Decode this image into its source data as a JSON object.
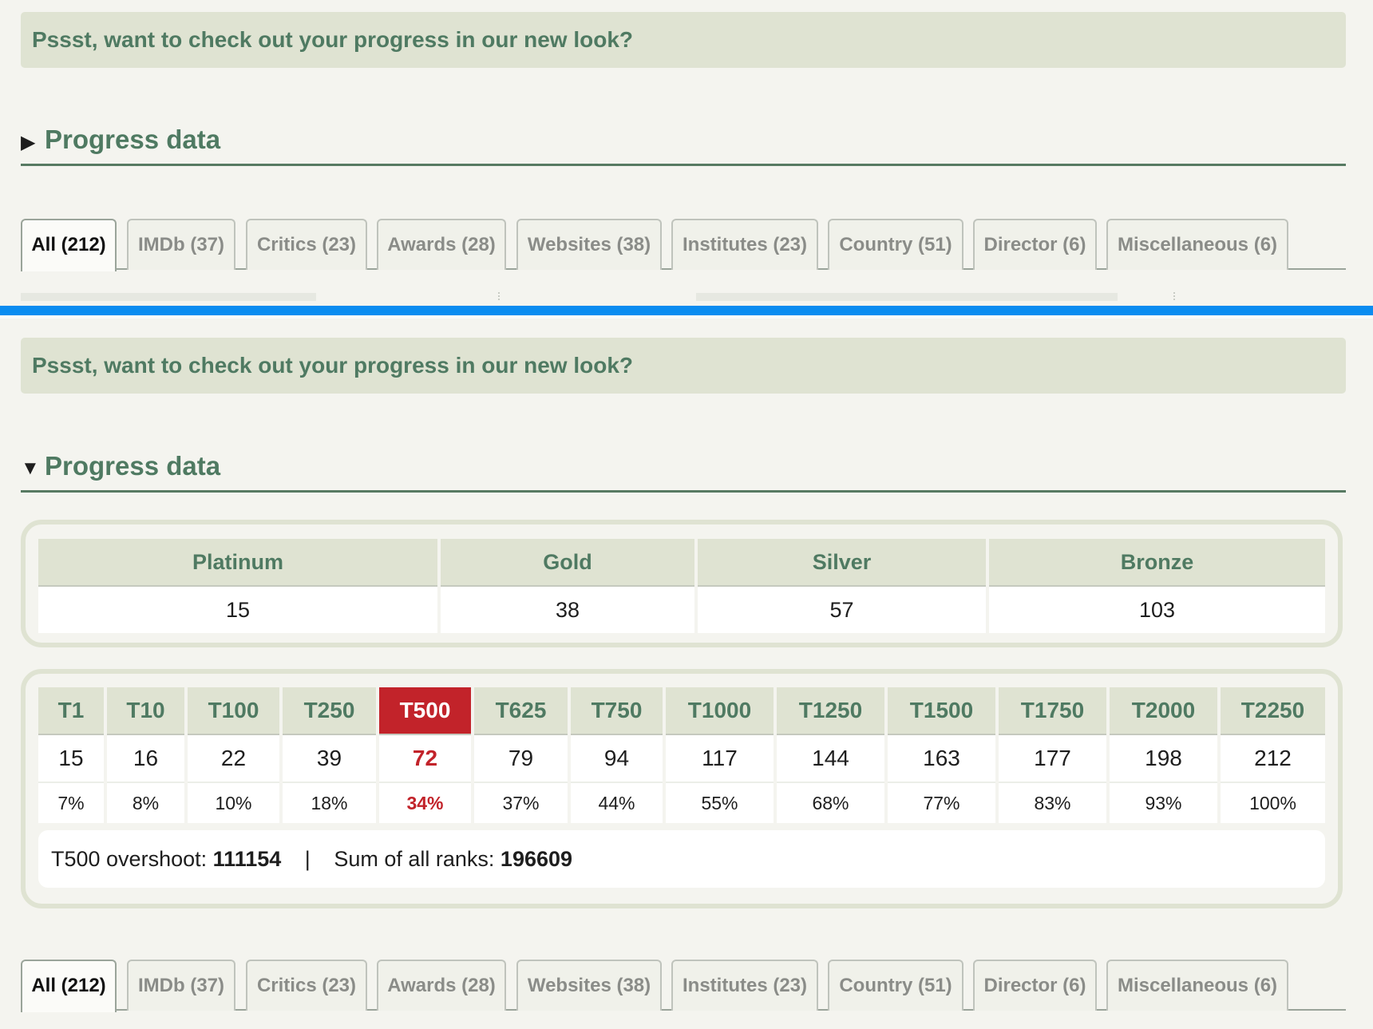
{
  "banner": {
    "text": "Pssst, want to check out your progress in our new look?"
  },
  "progress_section": {
    "title": "Progress data",
    "arrow_collapsed": "▶",
    "arrow_expanded": "▼"
  },
  "tabs": [
    {
      "label": "All (212)",
      "active": true
    },
    {
      "label": "IMDb (37)"
    },
    {
      "label": "Critics (23)"
    },
    {
      "label": "Awards (28)"
    },
    {
      "label": "Websites (38)"
    },
    {
      "label": "Institutes (23)"
    },
    {
      "label": "Country (51)"
    },
    {
      "label": "Director (6)"
    },
    {
      "label": "Miscellaneous (6)"
    }
  ],
  "medals": {
    "headers": [
      "Platinum",
      "Gold",
      "Silver",
      "Bronze"
    ],
    "values": [
      "15",
      "38",
      "57",
      "103"
    ]
  },
  "ranks": {
    "headers": [
      "T1",
      "T10",
      "T100",
      "T250",
      "T500",
      "T625",
      "T750",
      "T1000",
      "T1250",
      "T1500",
      "T1750",
      "T2000",
      "T2250"
    ],
    "counts": [
      "15",
      "16",
      "22",
      "39",
      "72",
      "79",
      "94",
      "117",
      "144",
      "163",
      "177",
      "198",
      "212"
    ],
    "percents": [
      "7%",
      "8%",
      "10%",
      "18%",
      "34%",
      "37%",
      "44%",
      "55%",
      "68%",
      "77%",
      "83%",
      "93%",
      "100%"
    ],
    "highlight": "T500",
    "highlight_color": "#c2232a"
  },
  "summary": {
    "overshoot_label": "T500 overshoot:",
    "overshoot_value": "111154",
    "separator": "|",
    "sum_label": "Sum of all ranks:",
    "sum_value": "196609"
  },
  "colors": {
    "accent_green": "#4f7a62",
    "banner_bg": "#dfe3d2",
    "divider_blue": "#0a8cf0"
  }
}
